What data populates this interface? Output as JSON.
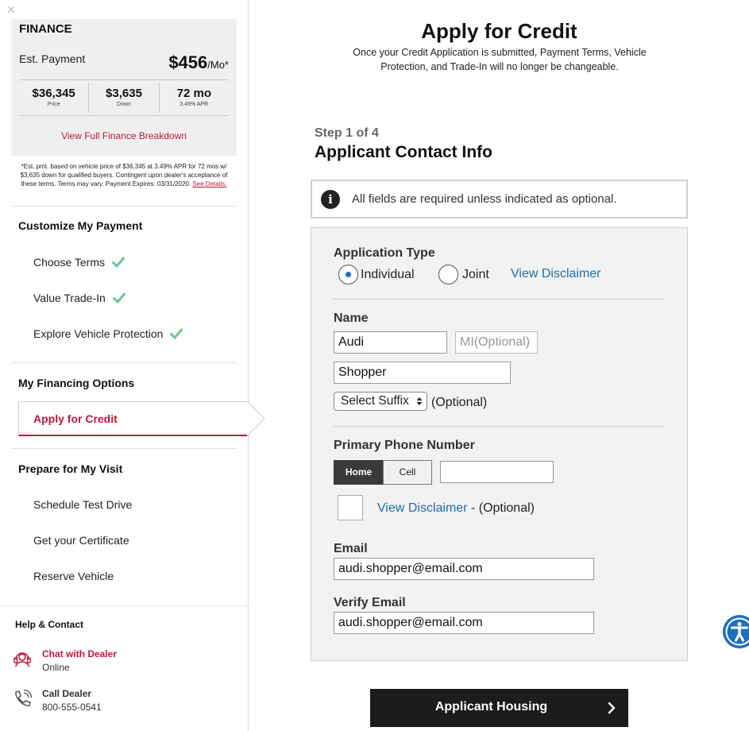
{
  "sidebar": {
    "close_glyph": "✕",
    "finance": {
      "title": "FINANCE",
      "est_label": "Est. Payment",
      "est_value": "$456",
      "est_unit": "/Mo*",
      "price_value": "$36,345",
      "price_label": "Price",
      "down_value": "$3,635",
      "down_label": "Down",
      "term_value": "72 mo",
      "term_label": "3.49% APR",
      "breakdown_link": "View Full Finance Breakdown",
      "note": "*Est. pmt. based on vehicle price of $36,345 at 3.49% APR for 72 mos w/ $3,635 down for qualified buyers. Contingent upon dealer's acceptance of these terms. Terms may vary. Payment Expires: 03/31/2020.",
      "see_details": "See Details."
    },
    "customize_heading": "Customize My Payment",
    "customize_items": [
      "Choose Terms",
      "Value Trade-In",
      "Explore Vehicle Protection"
    ],
    "financing_heading": "My Financing Options",
    "active_item": "Apply for Credit",
    "visit_heading": "Prepare for My Visit",
    "visit_items": [
      "Schedule Test Drive",
      "Get your Certificate",
      "Reserve Vehicle"
    ],
    "help_heading": "Help & Contact",
    "chat_title": "Chat with Dealer",
    "chat_status": "Online",
    "call_title": "Call Dealer",
    "call_number": "800-555-0541"
  },
  "main": {
    "title": "Apply for Credit",
    "subtitle": "Once your Credit Application is submitted, Payment Terms, Vehicle Protection, and Trade-In will no longer be changeable.",
    "step": "Step 1 of 4",
    "section_title": "Applicant Contact Info",
    "notice_icon": "i",
    "notice": "All fields are required unless indicated as optional.",
    "form": {
      "app_type_label": "Application Type",
      "individual_label": "Individual",
      "joint_label": "Joint",
      "disclaimer_link": "View Disclaimer",
      "name_label": "Name",
      "first_name": "Audi",
      "mi_placeholder": "MI(Optional)",
      "last_name": "Shopper",
      "suffix_value": "Select Suffix",
      "optional_text": "(Optional)",
      "phone_label": "Primary Phone Number",
      "phone_home": "Home",
      "phone_cell": "Cell",
      "phone_value": "",
      "phone_disclaimer_link": "View Disclaimer",
      "phone_disclaimer_suffix": " - (Optional)",
      "email_label": "Email",
      "email_value": "audi.shopper@email.com",
      "verify_email_label": "Verify Email",
      "verify_email_value": "audi.shopper@email.com"
    },
    "cta_label": "Applicant Housing"
  },
  "colors": {
    "accent_red": "#c0173c",
    "link_blue": "#1d6fa8",
    "check_green": "#4fb37a",
    "cta_bg": "#1c1c1c",
    "a11y_blue": "#1f6fc0"
  },
  "icons": {
    "check": "check-icon",
    "chat": "headset-icon",
    "call": "phone-icon",
    "cta_arrow": "chevron-right-icon",
    "accessibility": "accessibility-icon"
  }
}
